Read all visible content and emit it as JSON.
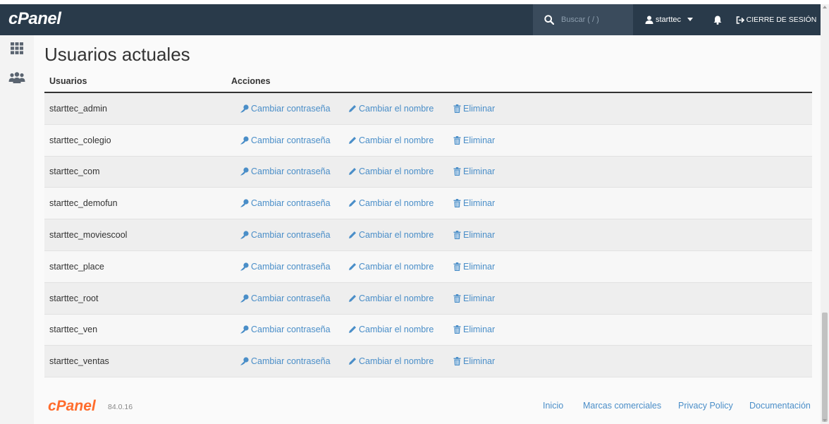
{
  "header": {
    "logo": "cPanel",
    "search_placeholder": "Buscar ( / )",
    "user": "starttec",
    "logout": "CIERRE DE SESIÓN"
  },
  "sidebar": {
    "items": [
      {
        "icon": "grid-icon"
      },
      {
        "icon": "users-icon"
      }
    ]
  },
  "page": {
    "title": "Usuarios actuales"
  },
  "table": {
    "columns": [
      "Usuarios",
      "Acciones"
    ],
    "rows": [
      "starttec_admin",
      "starttec_colegio",
      "starttec_com",
      "starttec_demofun",
      "starttec_moviescool",
      "starttec_place",
      "starttec_root",
      "starttec_ven",
      "starttec_ventas"
    ],
    "actions": {
      "change_password": "Cambiar contraseña",
      "rename": "Cambiar el nombre",
      "delete": "Eliminar"
    }
  },
  "footer": {
    "logo": "cPanel",
    "version": "84.0.16",
    "links": [
      "Inicio",
      "Marcas comerciales",
      "Privacy Policy",
      "Documentación"
    ]
  },
  "colors": {
    "navbar": "#293a4a",
    "link": "#4a8ec8",
    "brand": "#ff6c2c"
  }
}
